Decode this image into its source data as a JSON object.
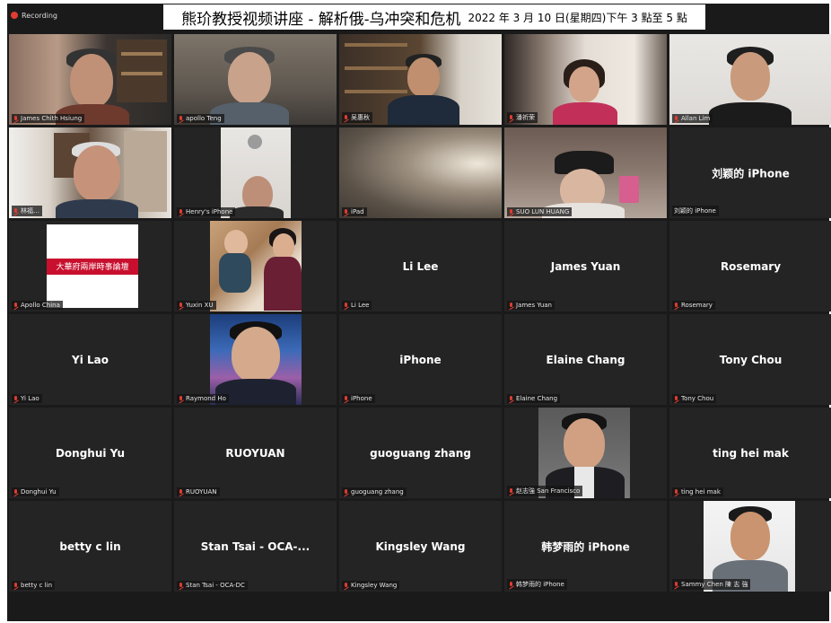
{
  "recording": {
    "label": "Recording"
  },
  "banner": {
    "title": "熊玠教授视频讲座 - 解析俄-乌冲突和危机",
    "date": "2022 年 3 月 10 日(星期四)下午 3 點至 5 點"
  },
  "logo_card": {
    "text": "大華府兩岸時事論壇"
  },
  "tiles": [
    {
      "name": "James Chith Hsiung",
      "video": true
    },
    {
      "name": "apollo Teng",
      "video": true
    },
    {
      "name": "吴惠秋",
      "video": true
    },
    {
      "name": "潘祈荣",
      "video": true
    },
    {
      "name": "Allan Lim",
      "video": true
    },
    {
      "name": "林福…",
      "video": true
    },
    {
      "name": "Henry's iPhone",
      "video": true
    },
    {
      "name": "iPad",
      "video": true
    },
    {
      "name": "SUO LUN HUANG",
      "video": true
    },
    {
      "name": "刘颖的 iPhone",
      "display": "刘颖的 iPhone",
      "video": false
    },
    {
      "name": "Apollo China",
      "video": true
    },
    {
      "name": "Yuxin XU",
      "video": true
    },
    {
      "name": "Li Lee",
      "display": "Li Lee",
      "video": false
    },
    {
      "name": "James Yuan",
      "display": "James Yuan",
      "video": false
    },
    {
      "name": "Rosemary",
      "display": "Rosemary",
      "video": false
    },
    {
      "name": "Yi Lao",
      "display": "Yi Lao",
      "video": false
    },
    {
      "name": "Raymond Ho",
      "video": true
    },
    {
      "name": "iPhone",
      "display": "iPhone",
      "video": false
    },
    {
      "name": "Elaine Chang",
      "display": "Elaine Chang",
      "video": false
    },
    {
      "name": "Tony Chou",
      "display": "Tony Chou",
      "video": false
    },
    {
      "name": "Donghui Yu",
      "display": "Donghui Yu",
      "video": false
    },
    {
      "name": "RUOYUAN",
      "display": "RUOYUAN",
      "video": false
    },
    {
      "name": "guoguang zhang",
      "display": "guoguang zhang",
      "video": false
    },
    {
      "name": "赵志強 San Francisco",
      "video": true
    },
    {
      "name": "ting hei mak",
      "display": "ting hei mak",
      "video": false
    },
    {
      "name": "betty c lin",
      "display": "betty c lin",
      "video": false
    },
    {
      "name": "Stan Tsai - OCA-DC",
      "display": "Stan Tsai - OCA-...",
      "video": false
    },
    {
      "name": "Kingsley Wang",
      "display": "Kingsley Wang",
      "video": false
    },
    {
      "name": "韩梦雨的 iPhone",
      "display": "韩梦雨的 iPhone",
      "video": false
    },
    {
      "name": "Sammy Chen 陳 志 強",
      "video": true
    }
  ],
  "colors": {
    "background": "#1a1a1a",
    "tile": "#242424",
    "active_speaker": "#c9e27b",
    "muted_mic": "#e03c31",
    "logo_red": "#c8102e"
  }
}
